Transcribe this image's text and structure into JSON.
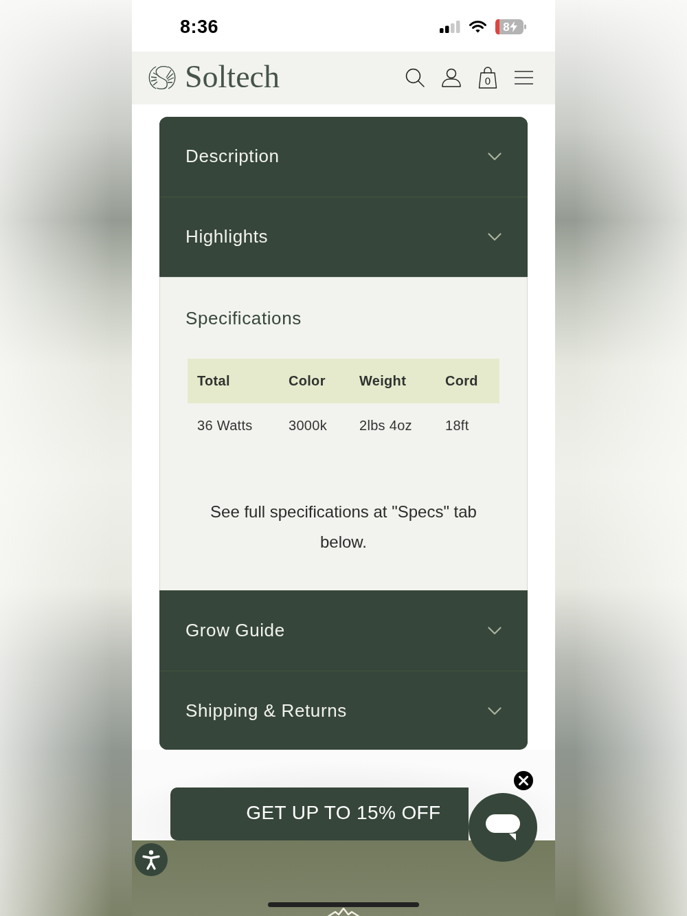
{
  "status_bar": {
    "time": "8:36",
    "battery_text": "8",
    "charging": true
  },
  "header": {
    "brand": "Soltech",
    "cart_count": "0"
  },
  "accordion": [
    {
      "title": "Description",
      "expanded": false
    },
    {
      "title": "Highlights",
      "expanded": false
    },
    {
      "title": "Specifications",
      "expanded": true,
      "table": {
        "columns": [
          "Total",
          "Color",
          "Weight",
          "Cord"
        ],
        "rows": [
          [
            "36 Watts",
            "3000k",
            "2lbs 4oz",
            "18ft"
          ]
        ]
      },
      "note": "See full specifications at \"Specs\" tab below."
    },
    {
      "title": "Grow Guide",
      "expanded": false
    },
    {
      "title": "Shipping & Returns",
      "expanded": false
    }
  ],
  "promo": {
    "label": "GET UP TO 15% OFF"
  }
}
